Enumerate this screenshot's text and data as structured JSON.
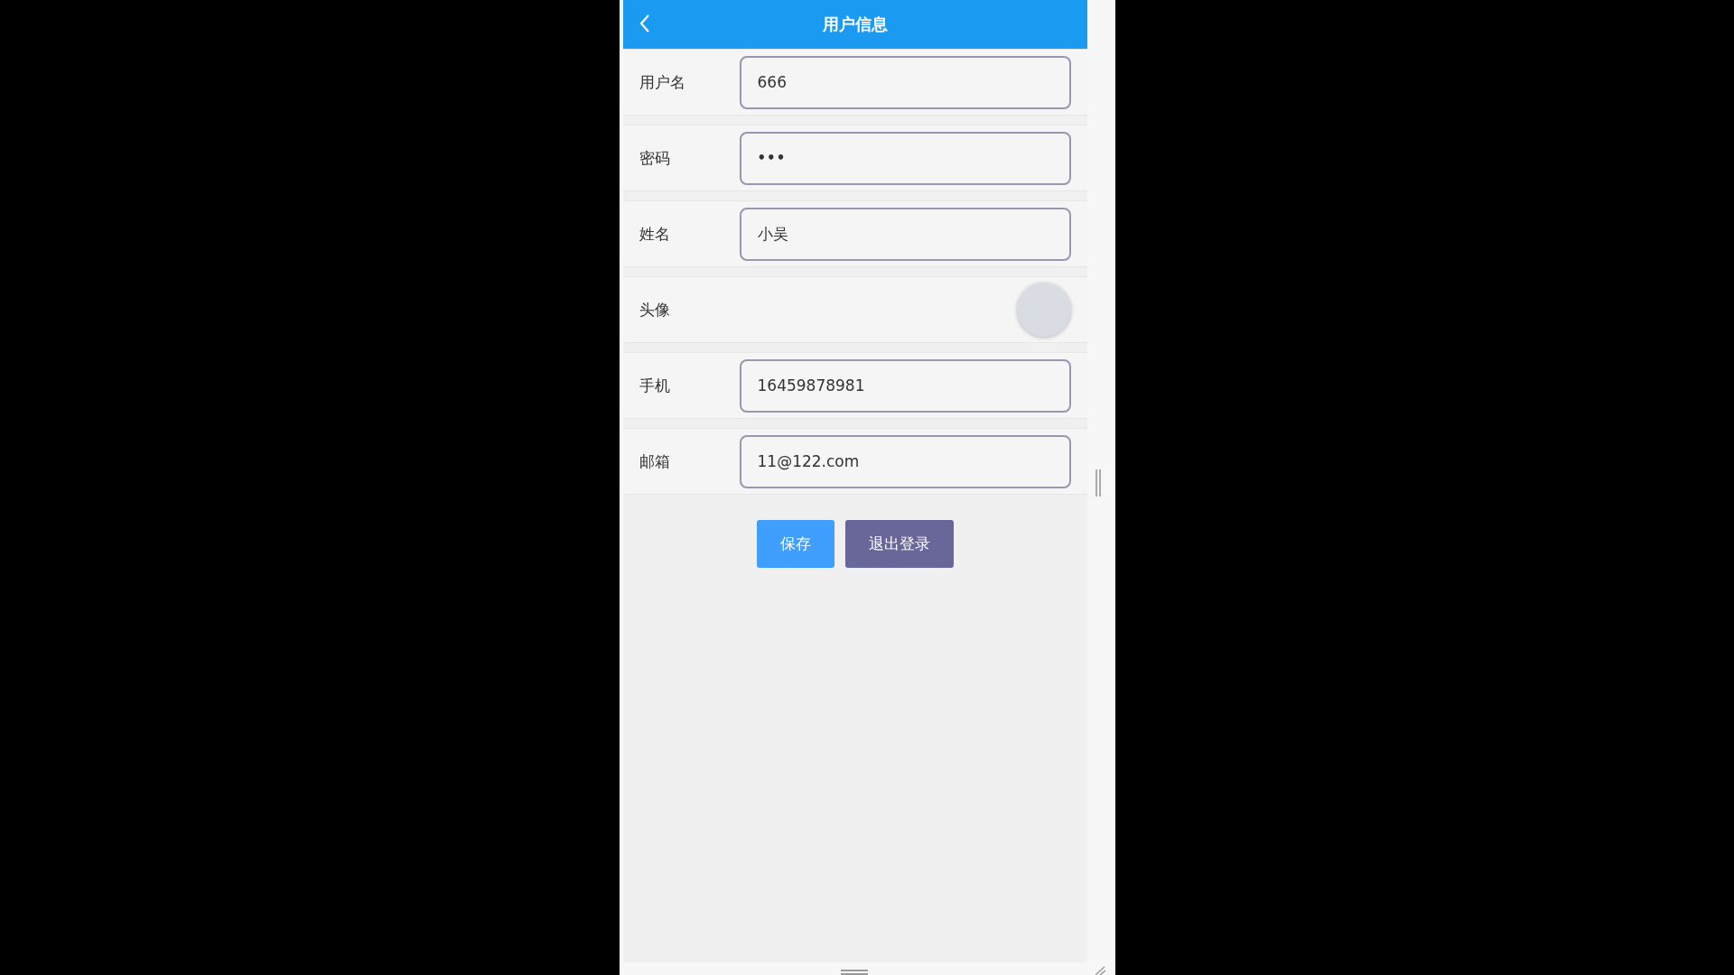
{
  "header": {
    "title": "用户信息"
  },
  "fields": [
    {
      "kind": "text",
      "label": "用户名",
      "value": "666"
    },
    {
      "kind": "password",
      "label": "密码",
      "value": "•••"
    },
    {
      "kind": "text",
      "label": "姓名",
      "value": "小吴"
    },
    {
      "kind": "avatar",
      "label": "头像"
    },
    {
      "kind": "text",
      "label": "手机",
      "value": "16459878981"
    },
    {
      "kind": "text",
      "label": "邮箱",
      "value": "11@122.com"
    }
  ],
  "buttons": [
    {
      "kind": "primary",
      "label": "保存"
    },
    {
      "kind": "secondary",
      "label": "退出登录"
    }
  ]
}
